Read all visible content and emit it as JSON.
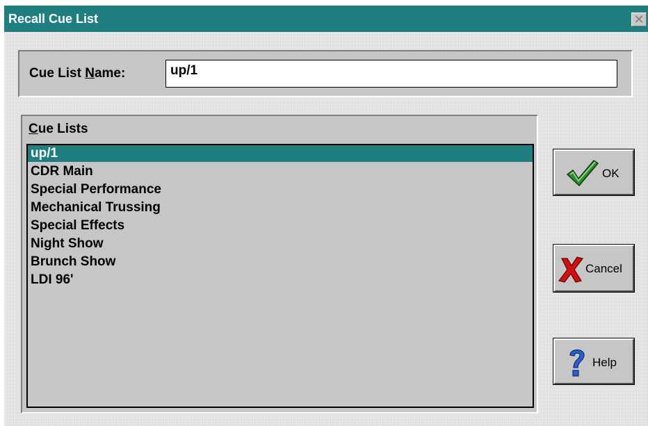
{
  "window": {
    "title": "Recall Cue List",
    "close_glyph": "✕"
  },
  "name_field": {
    "label_pre": "Cue List ",
    "label_accel": "N",
    "label_post": "ame:",
    "value": "up/1"
  },
  "cue_lists": {
    "label_accel": "C",
    "label_post": "ue Lists",
    "items": [
      "up/1",
      "CDR Main",
      "Special Performance",
      "Mechanical Trussing",
      "Special Effects",
      "Night Show",
      "Brunch Show",
      "LDI 96'"
    ],
    "selected_index": 0
  },
  "buttons": {
    "ok": {
      "label": "OK",
      "icon": "checkmark-icon"
    },
    "cancel": {
      "label": "Cancel",
      "icon": "red-x-icon"
    },
    "help": {
      "label": "Help",
      "icon": "question-mark-icon"
    }
  },
  "colors": {
    "titlebar": "#1f7f80",
    "selection": "#1f7f80",
    "check_green": "#2e8b2e",
    "cancel_red": "#d01010",
    "help_blue": "#2b5fd0"
  }
}
